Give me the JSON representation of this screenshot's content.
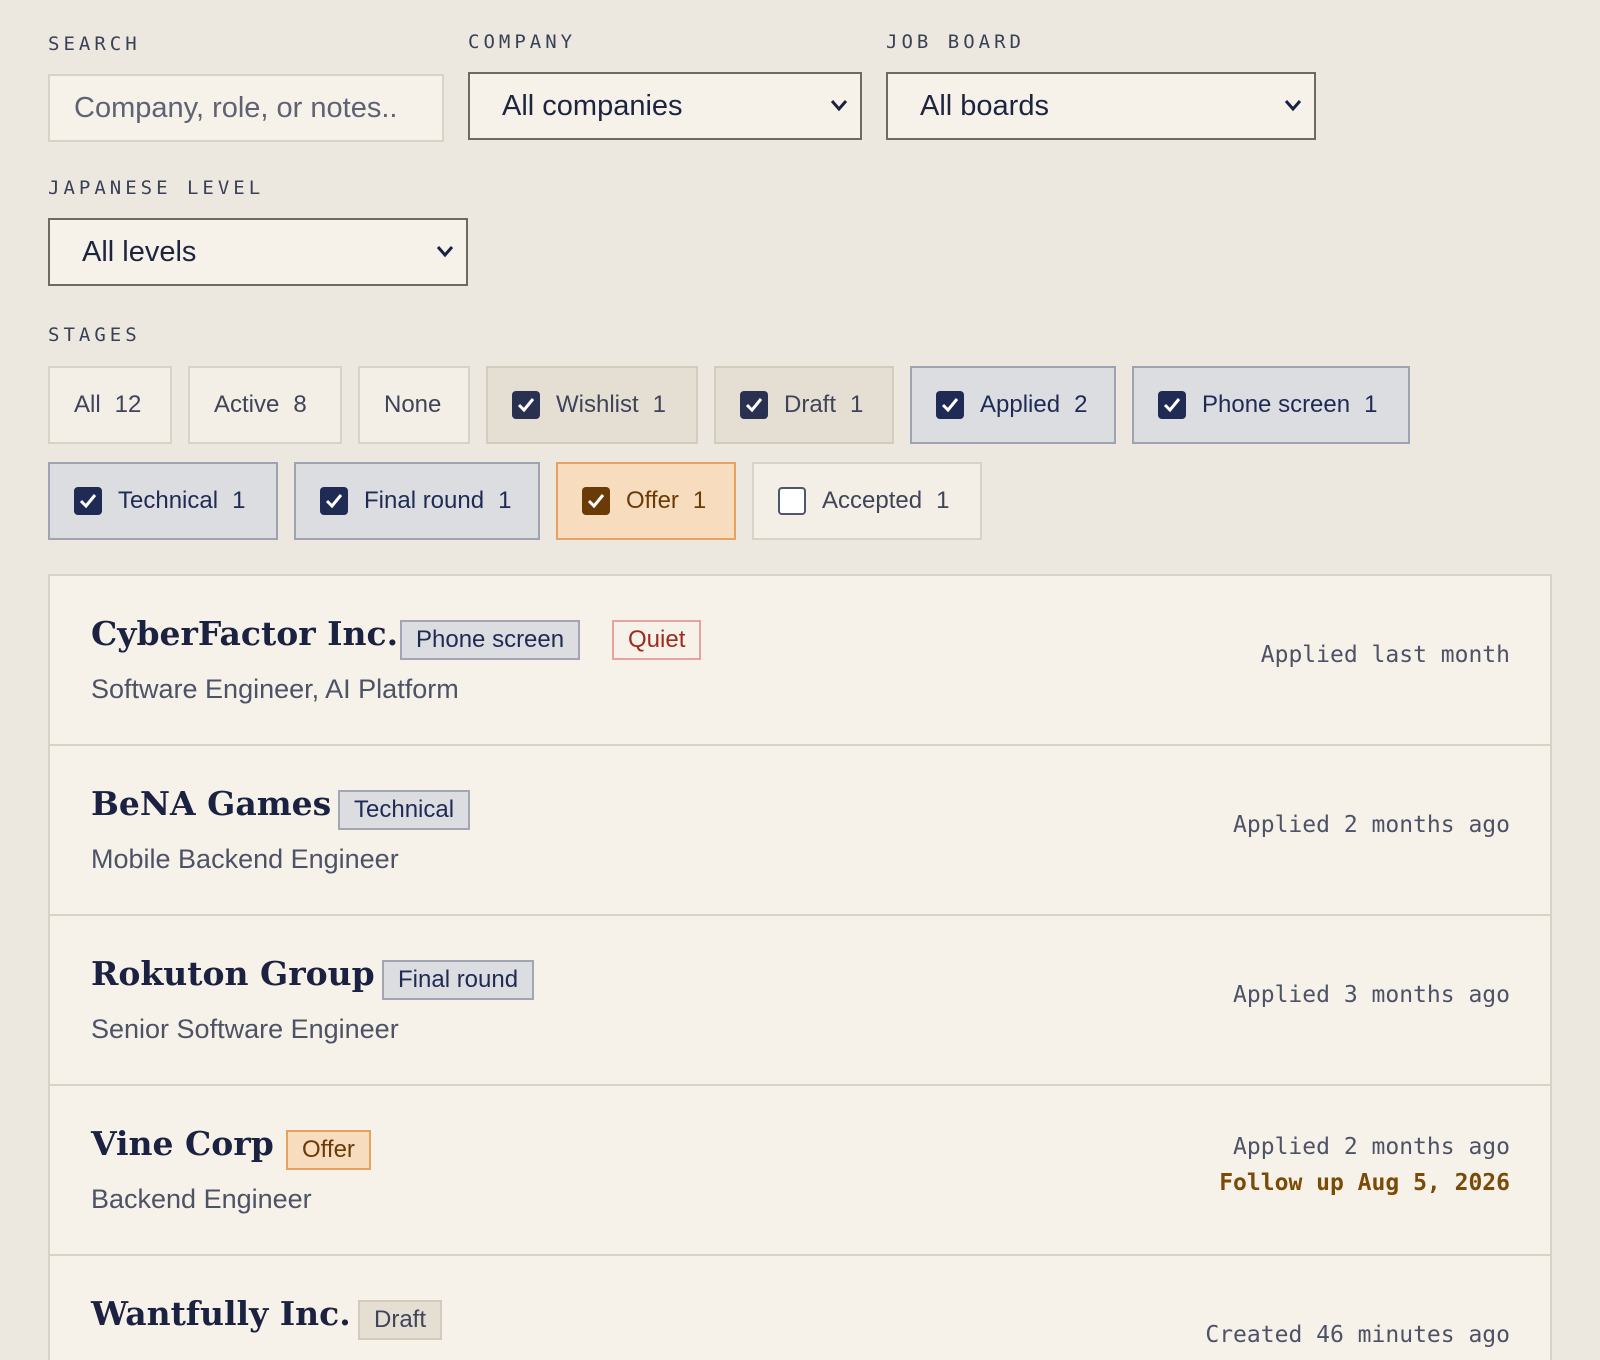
{
  "filters": {
    "search": {
      "label": "SEARCH",
      "placeholder": "Company, role, or notes.."
    },
    "company": {
      "label": "COMPANY",
      "value": "All companies"
    },
    "job_board": {
      "label": "JOB BOARD",
      "value": "All boards"
    },
    "japanese_level": {
      "label": "JAPANESE LEVEL",
      "value": "All levels"
    }
  },
  "stages": {
    "label": "STAGES",
    "all": {
      "label": "All",
      "count": "12"
    },
    "active": {
      "label": "Active",
      "count": "8"
    },
    "none": {
      "label": "None"
    },
    "chips": [
      {
        "label": "Wishlist",
        "count": "1",
        "checked": true
      },
      {
        "label": "Draft",
        "count": "1",
        "checked": true
      },
      {
        "label": "Applied",
        "count": "2",
        "checked": true
      },
      {
        "label": "Phone screen",
        "count": "1",
        "checked": true
      },
      {
        "label": "Technical",
        "count": "1",
        "checked": true
      },
      {
        "label": "Final round",
        "count": "1",
        "checked": true
      },
      {
        "label": "Offer",
        "count": "1",
        "checked": true
      },
      {
        "label": "Accepted",
        "count": "1",
        "checked": false
      }
    ]
  },
  "applications": [
    {
      "company": "CyberFactor Inc.",
      "stage": "Phone screen",
      "tag": "Quiet",
      "role": "Software Engineer, AI Platform",
      "status": "Applied last month"
    },
    {
      "company": "BeNA Games",
      "stage": "Technical",
      "role": "Mobile Backend Engineer",
      "status": "Applied 2 months ago"
    },
    {
      "company": "Rokuton Group",
      "stage": "Final round",
      "role": "Senior Software Engineer",
      "status": "Applied 3 months ago"
    },
    {
      "company": "Vine Corp",
      "stage": "Offer",
      "role": "Backend Engineer",
      "status": "Applied 2 months ago",
      "follow_up": "Follow up Aug 5, 2026"
    },
    {
      "company": "Wantfully Inc.",
      "stage": "Draft",
      "status": "Created 46 minutes ago"
    }
  ],
  "colors": {
    "background": "#ece8df",
    "navy": "#1f2a55",
    "offer": "#f7dcbd",
    "quiet": "#a02a20"
  }
}
